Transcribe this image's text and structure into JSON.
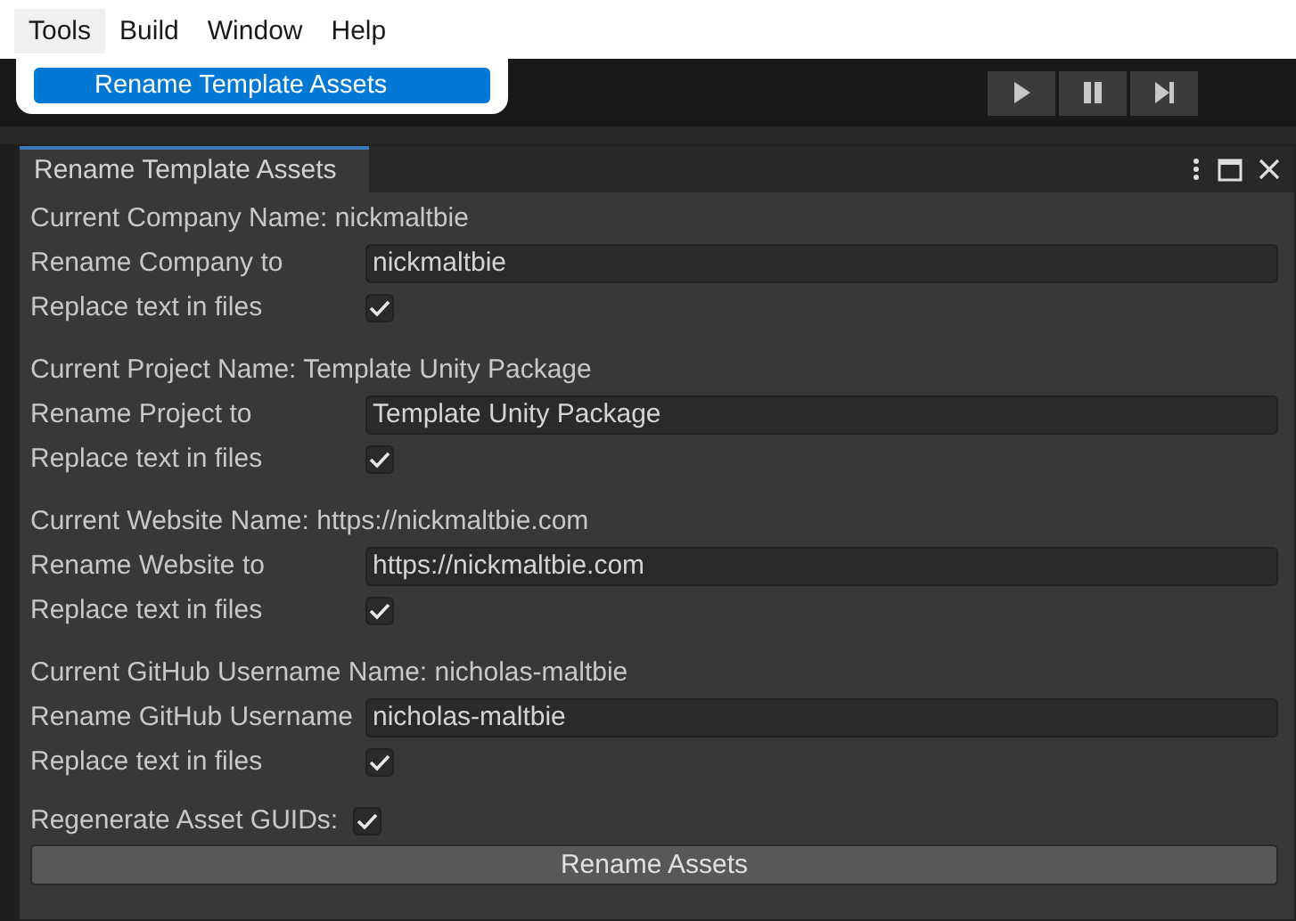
{
  "menu_bar": {
    "items": [
      {
        "label": "Tools",
        "selected": true
      },
      {
        "label": "Build",
        "selected": false
      },
      {
        "label": "Window",
        "selected": false
      },
      {
        "label": "Help",
        "selected": false
      }
    ]
  },
  "dropdown": {
    "items": [
      {
        "label": "Rename Template Assets",
        "selected": true
      }
    ]
  },
  "window": {
    "title": "Rename Template Assets"
  },
  "sections": [
    {
      "current": "Current Company Name: nickmaltbie",
      "rename_label": "Rename Company to",
      "value": "nickmaltbie",
      "replace_label": "Replace text in files",
      "checked": true
    },
    {
      "current": "Current Project Name: Template Unity Package",
      "rename_label": "Rename Project to",
      "value": "Template Unity Package",
      "replace_label": "Replace text in files",
      "checked": true
    },
    {
      "current": "Current Website Name: https://nickmaltbie.com",
      "rename_label": "Rename Website to",
      "value": "https://nickmaltbie.com",
      "replace_label": "Replace text in files",
      "checked": true
    },
    {
      "current": "Current GitHub Username Name: nicholas-maltbie",
      "rename_label": "Rename GitHub Username",
      "value": "nicholas-maltbie",
      "replace_label": "Replace text in files",
      "checked": true
    }
  ],
  "regenerate": {
    "label": "Regenerate Asset GUIDs:",
    "checked": true
  },
  "action_button": "Rename Assets"
}
